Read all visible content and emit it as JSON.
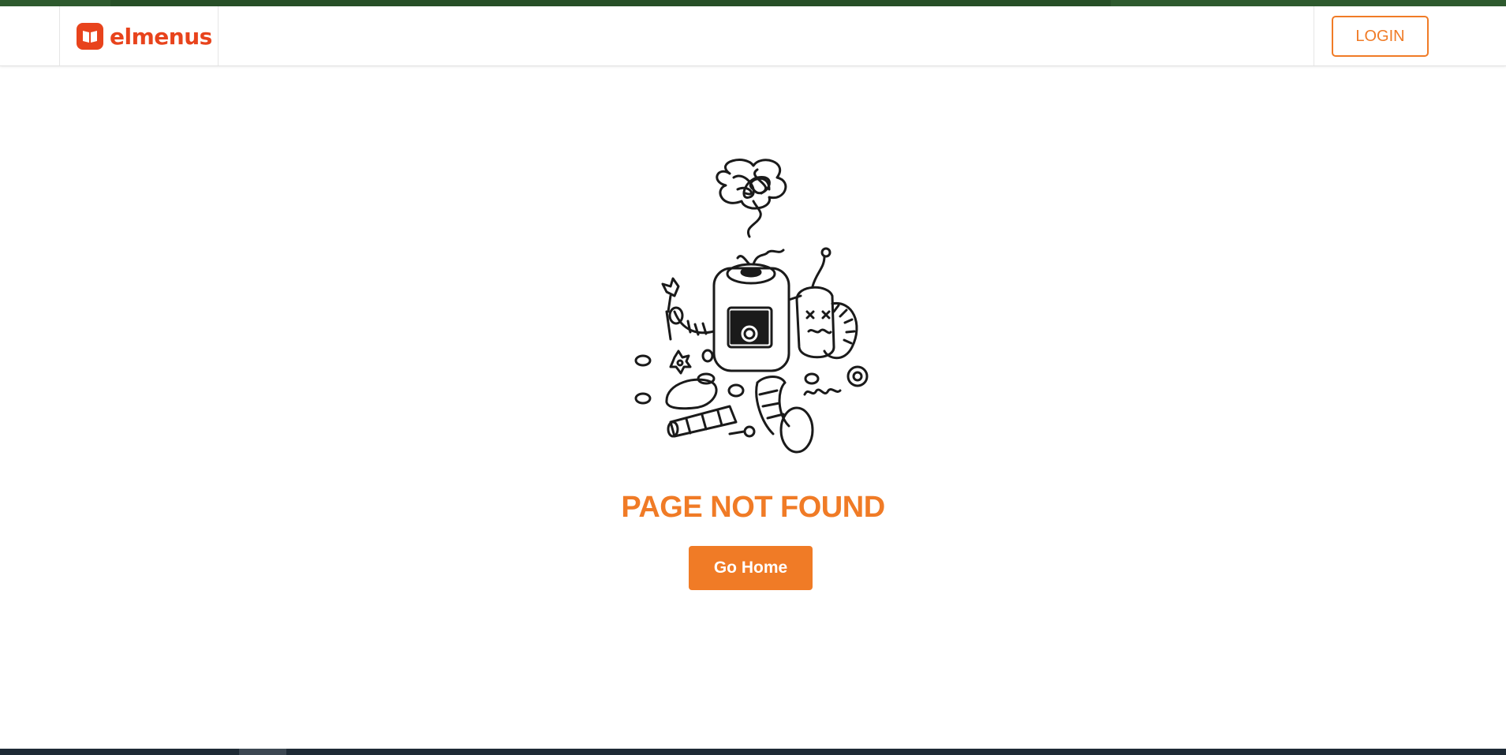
{
  "loading_bar": {
    "color": "#2e5a2e"
  },
  "header": {
    "logo": {
      "text": "elmenus",
      "icon": "elmenus-book-icon",
      "color": "#e8431c"
    },
    "login_label": "LOGIN"
  },
  "main": {
    "illustration": {
      "icon": "broken-robot-illustration"
    },
    "title": "PAGE NOT FOUND",
    "home_button_label": "Go Home",
    "accent_color": "#f07b26"
  }
}
